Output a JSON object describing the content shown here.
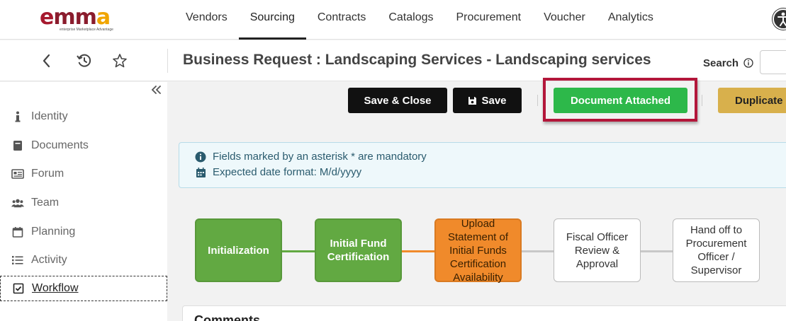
{
  "logo": {
    "text_e": "e",
    "text_mm": "mm",
    "text_a": "a",
    "tagline": "enterprise Marketplace Advantage"
  },
  "nav": {
    "items": [
      {
        "label": "Vendors",
        "active": false
      },
      {
        "label": "Sourcing",
        "active": true
      },
      {
        "label": "Contracts",
        "active": false
      },
      {
        "label": "Catalogs",
        "active": false
      },
      {
        "label": "Procurement",
        "active": false
      },
      {
        "label": "Voucher",
        "active": false
      },
      {
        "label": "Analytics",
        "active": false
      }
    ]
  },
  "header": {
    "title": "Business Request : Landscaping Services - Landscaping services",
    "search_label": "Search",
    "search_value": ""
  },
  "sidebar": {
    "items": [
      {
        "label": "Identity",
        "icon": "info-icon"
      },
      {
        "label": "Documents",
        "icon": "book-icon"
      },
      {
        "label": "Forum",
        "icon": "newspaper-icon"
      },
      {
        "label": "Team",
        "icon": "users-icon"
      },
      {
        "label": "Planning",
        "icon": "calendar-icon"
      },
      {
        "label": "Activity",
        "icon": "list-icon"
      },
      {
        "label": "Workflow",
        "icon": "checkbox-icon"
      }
    ],
    "active": "Workflow"
  },
  "toolbar": {
    "save_close": "Save & Close",
    "save": "Save",
    "document_attached": "Document Attached",
    "duplicate": "Duplicate"
  },
  "info": {
    "mandatory": "Fields marked by an asterisk * are mandatory",
    "date_format": "Expected date format: M/d/yyyy"
  },
  "workflow": {
    "steps": [
      {
        "label": "Initialization",
        "status": "done"
      },
      {
        "label": "Initial Fund Certification",
        "status": "done"
      },
      {
        "label": "Upload Statement of Initial Funds Certification Availability",
        "status": "current"
      },
      {
        "label": "Fiscal Officer Review & Approval",
        "status": "pending"
      },
      {
        "label": "Hand off to Procurement Officer / Supervisor",
        "status": "pending"
      }
    ]
  },
  "comments": {
    "title": "Comments"
  },
  "colors": {
    "done": "#62a942",
    "current": "#f08a2b",
    "pending": "#ffffff",
    "highlight": "#b3163a",
    "green_button": "#2db84a",
    "gold_button": "#d8b04c"
  }
}
